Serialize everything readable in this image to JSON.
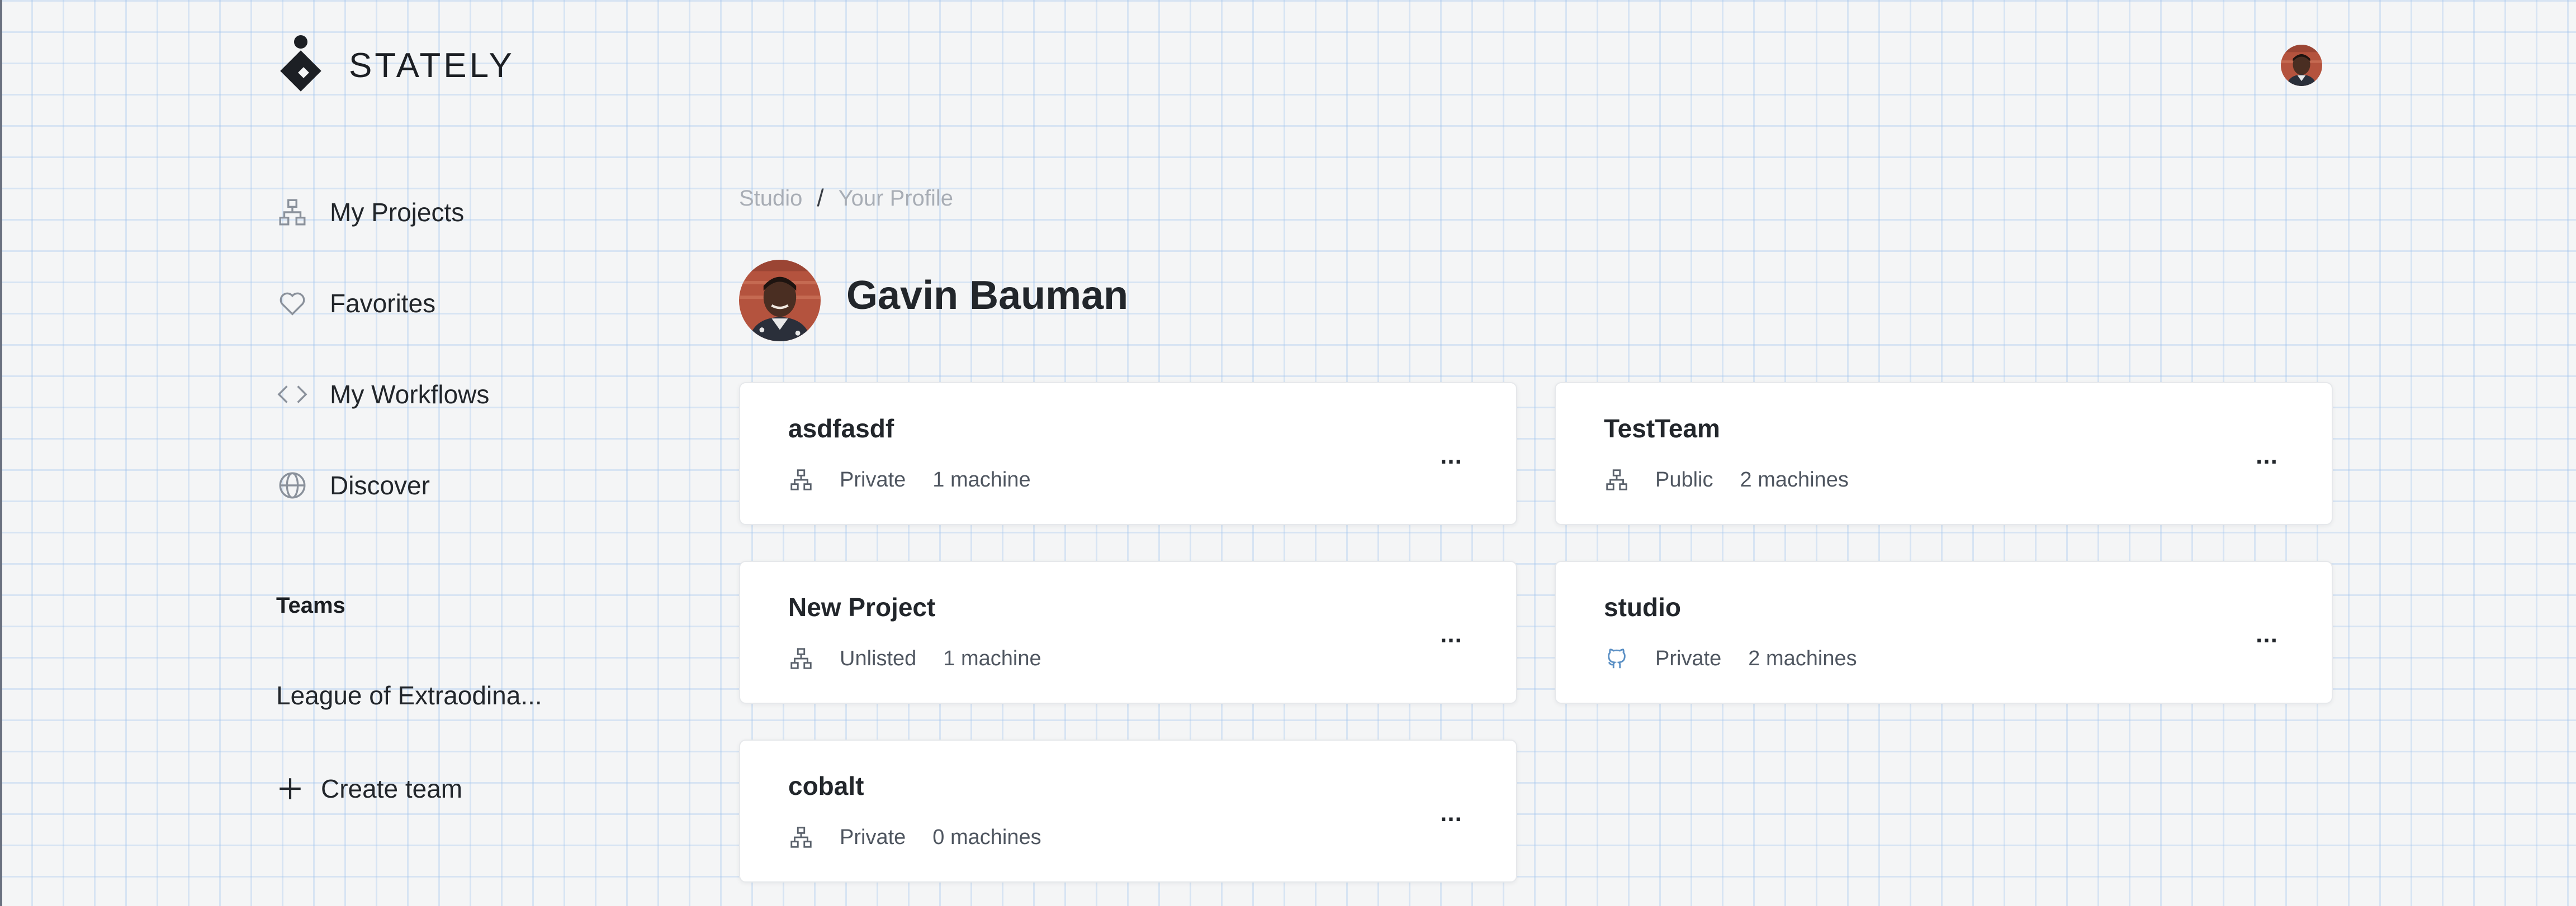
{
  "app": {
    "logo_text": "STATELY"
  },
  "sidebar": {
    "nav": [
      {
        "label": "My Projects",
        "icon": "hierarchy-icon"
      },
      {
        "label": "Favorites",
        "icon": "heart-icon"
      },
      {
        "label": "My Workflows",
        "icon": "code-icon"
      },
      {
        "label": "Discover",
        "icon": "globe-icon"
      }
    ],
    "teams_heading": "Teams",
    "teams": [
      {
        "label": "League of Extraodina..."
      }
    ],
    "create_team_label": "Create team"
  },
  "breadcrumb": {
    "items": [
      "Studio",
      "Your Profile"
    ],
    "separator": "/"
  },
  "profile": {
    "name": "Gavin Bauman"
  },
  "projects": [
    {
      "title": "asdfasdf",
      "visibility": "Private",
      "machines": "1 machine",
      "icon": "hierarchy-icon"
    },
    {
      "title": "TestTeam",
      "visibility": "Public",
      "machines": "2 machines",
      "icon": "hierarchy-icon"
    },
    {
      "title": "New Project",
      "visibility": "Unlisted",
      "machines": "1 machine",
      "icon": "hierarchy-icon"
    },
    {
      "title": "studio",
      "visibility": "Private",
      "machines": "2 machines",
      "icon": "github-icon"
    },
    {
      "title": "cobalt",
      "visibility": "Private",
      "machines": "0 machines",
      "icon": "hierarchy-icon"
    }
  ],
  "menu_glyph": "...",
  "colors": {
    "background": "#f4f5f6",
    "grid": "#96bee8",
    "card": "#ffffff",
    "text": "#22262b",
    "muted": "#a8adb5",
    "github_icon": "#5a8fc4"
  }
}
